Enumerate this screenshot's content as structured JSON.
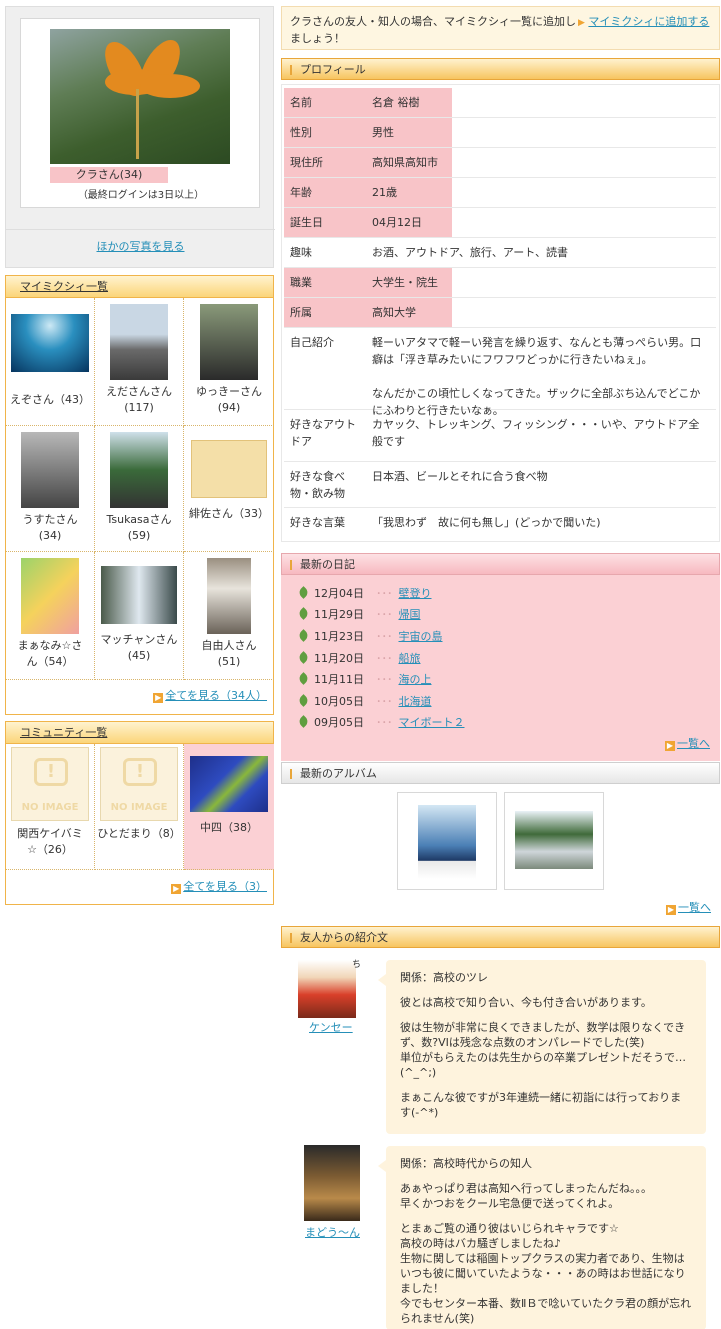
{
  "profile_photo": {
    "name": "クラさん(34)",
    "last_login": "（最終ログインは3日以上）",
    "other_photos": "ほかの写真を見る"
  },
  "mymixi": {
    "title": "マイミクシィ一覧",
    "friends": [
      {
        "name": "えぞさん（43）"
      },
      {
        "name": "えださんさん",
        "count": "(117)"
      },
      {
        "name": "ゆっきーさん",
        "count": "(94)"
      },
      {
        "name": "うすたさん",
        "count": "(34)"
      },
      {
        "name": "Tsukasaさん",
        "count": "(59)"
      },
      {
        "name": "緋佐さん（33）"
      },
      {
        "name": "まぁなみ☆さ",
        "count": "ん（54）"
      },
      {
        "name": "マッチャンさん",
        "count": "(45)"
      },
      {
        "name": "自由人さん",
        "count": "(51)"
      }
    ],
    "see_all": "全てを見る（34人）"
  },
  "community": {
    "title": "コミュニティ一覧",
    "items": [
      {
        "name": "関西ケイバミ",
        "count": "☆（26）",
        "noimage": "NO IMAGE"
      },
      {
        "name": "ひとだまり（8）",
        "noimage": "NO IMAGE"
      },
      {
        "name": "中四（38）"
      }
    ],
    "see_all": "全てを見る（3）"
  },
  "notice": {
    "text": "クラさんの友人・知人の場合、マイミクシィ一覧に追加しましょう！",
    "add_link": "マイミクシィに追加する"
  },
  "profile": {
    "title": "プロフィール",
    "rows": [
      {
        "key": "名前",
        "value": "名倉 裕樹"
      },
      {
        "key": "性別",
        "value": "男性"
      },
      {
        "key": "現住所",
        "value": "高知県高知市"
      },
      {
        "key": "年齢",
        "value": "21歳"
      },
      {
        "key": "誕生日",
        "value": "04月12日"
      },
      {
        "key": "趣味",
        "value": "お酒、アウトドア、旅行、アート、読書"
      },
      {
        "key": "職業",
        "value": "大学生・院生"
      },
      {
        "key": "所属",
        "value": "高知大学"
      },
      {
        "key": "自己紹介",
        "value": "軽ーいアタマで軽ーい発言を繰り返す、なんとも薄っぺらい男。口癖は「浮き草みたいにフワフワどっかに行きたいねぇ」。\n\nなんだかこの頃忙しくなってきた。ザックに全部ぶち込んでどこかにふわりと行きたいなぁ。"
      },
      {
        "key": "好きなアウトドア",
        "value": "カヤック、トレッキング、フィッシング・・・いや、アウトドア全般です"
      },
      {
        "key": "好きな食べ物・飲み物",
        "value": "日本酒、ビールとそれに合う食べ物"
      },
      {
        "key": "好きな言葉",
        "value": "「我思わず　故に何も無し」(どっかで聞いた)"
      }
    ]
  },
  "diary": {
    "title": "最新の日記",
    "entries": [
      {
        "date": "12月04日",
        "title": "壁登り"
      },
      {
        "date": "11月29日",
        "title": "帰国"
      },
      {
        "date": "11月23日",
        "title": "宇宙の島"
      },
      {
        "date": "11月20日",
        "title": "船旅"
      },
      {
        "date": "11月11日",
        "title": "海の上"
      },
      {
        "date": "10月05日",
        "title": "北海道"
      },
      {
        "date": "09月05日",
        "title": "マイボート２"
      }
    ],
    "list_link": "一覧へ"
  },
  "album": {
    "title": "最新のアルバム",
    "list_link": "一覧へ"
  },
  "introductions": {
    "title": "友人からの紹介文",
    "items": [
      {
        "friend": "ケンセー",
        "relation": "関係：高校のツレ",
        "p1": "彼とは高校で知り合い、今も付き合いがあります。",
        "p2": "彼は生物が非常に良くできましたが、数学は限りなくできず、数?VIは残念な点数のオンパレードでした(笑)\n単位がもらえたのは先生からの卒業プレゼントだそうで…(^_^;)",
        "p3": "まぁこんな彼ですが3年連続一緒に初詣には行っております(-^*)"
      },
      {
        "friend": "まどう〜ん",
        "relation": "関係：高校時代からの知人",
        "p1": "あぁやっぱり君は高知へ行ってしまったんだね。。。\n早くかつおをクール宅急便で送ってくれよ。",
        "p2": "とまぁご覧の通り彼はいじられキャラです☆\n高校の時はバカ騒ぎしましたね♪\n生物に関しては稲園トップクラスの実力者であり、生物はいつも彼に聞いていたような・・・あの時はお世話になりました！\n今でもセンター本番、数ⅡＢで唸いていたクラ君の顔が忘れられません(笑)"
      }
    ]
  }
}
